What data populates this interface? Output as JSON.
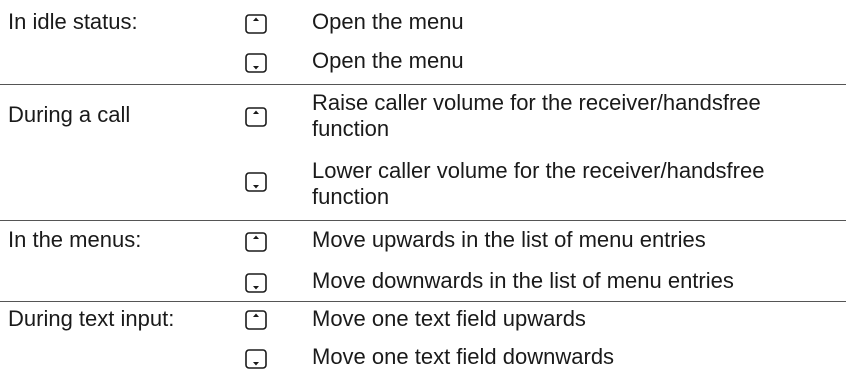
{
  "rows": [
    {
      "label": "In idle status:",
      "entries": [
        {
          "key": "up-key-icon",
          "text": "Open the menu"
        },
        {
          "key": "down-key-icon",
          "text": "Open the menu"
        }
      ]
    },
    {
      "label": "During a call",
      "entries": [
        {
          "key": "up-key-icon",
          "text": "Raise caller volume for the receiver/handsfree function"
        },
        {
          "key": "down-key-icon",
          "text": "Lower caller volume for the receiver/handsfree function"
        }
      ]
    },
    {
      "label": "In the menus:",
      "entries": [
        {
          "key": "up-key-icon",
          "text": "Move upwards in the list of menu entries"
        },
        {
          "key": "down-key-icon",
          "text": "Move downwards in the list of menu entries"
        }
      ]
    },
    {
      "label": "During text input:",
      "entries": [
        {
          "key": "up-key-icon",
          "text": "Move one text field upwards"
        },
        {
          "key": "down-key-icon",
          "text": "Move one text field downwards"
        }
      ]
    }
  ]
}
